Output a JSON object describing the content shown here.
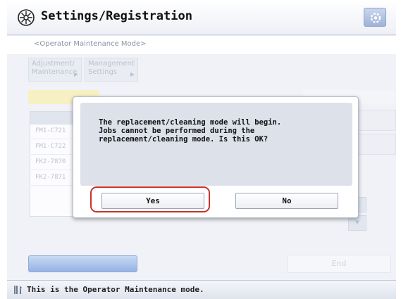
{
  "header": {
    "title": "Settings/Registration",
    "app_icon": "settings-registration-icon",
    "gear_icon": "gear-icon"
  },
  "mode_bar": {
    "text": "<Operator Maintenance Mode>"
  },
  "nav": [
    {
      "label_line1": "Adjustment/",
      "label_line2": "Maintenance"
    },
    {
      "label_line1": "Management",
      "label_line2": "Settings"
    }
  ],
  "table": {
    "rows": [
      "FM1-C721",
      "FM1-C722",
      "FK2-7870",
      "FK2-7871"
    ]
  },
  "dialog": {
    "message": "The replacement/cleaning mode will begin.\nJobs cannot be performed during the\nreplacement/cleaning mode. Is this OK?",
    "yes_label": "Yes",
    "no_label": "No"
  },
  "bottom": {
    "end_label": "End"
  },
  "status": {
    "message": "This is the Operator Maintenance mode.",
    "icon": "wrench-tool-icon"
  },
  "colors": {
    "highlight": "#c8332c",
    "accent_blue": "#5c8ad6"
  }
}
